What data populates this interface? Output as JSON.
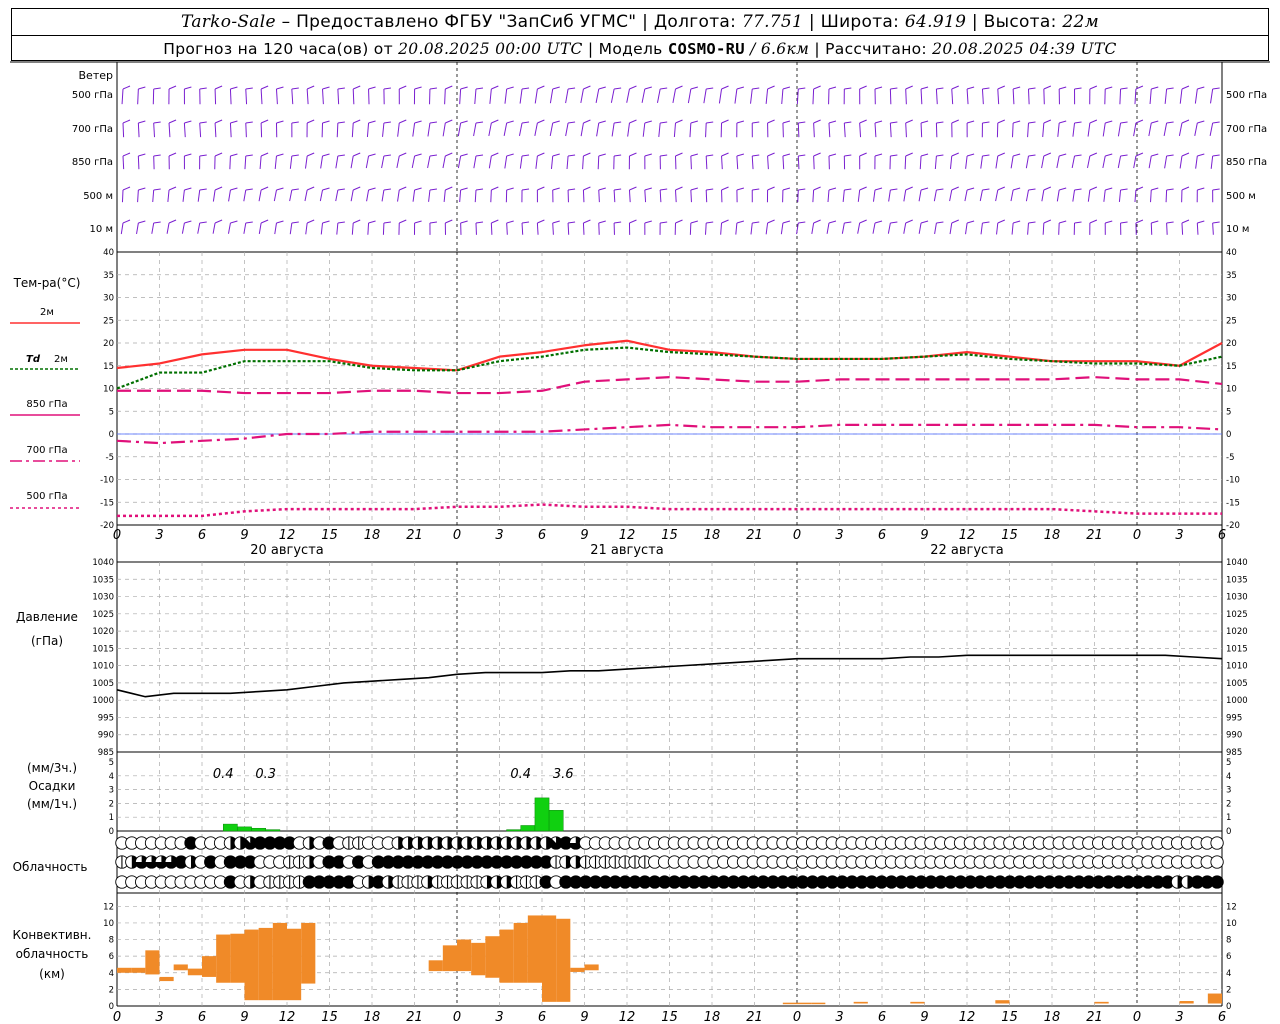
{
  "header": {
    "station": "Tarko-Sale",
    "dash": "–",
    "provider": "Предоставлено ФГБУ \"ЗапСиб УГМС\"",
    "lon_label": "Долгота:",
    "lon_value": "77.751",
    "lat_label": "Широта:",
    "lat_value": "64.919",
    "alt_label": "Высота:",
    "alt_value": "22м",
    "forecast_prefix": "Прогноз на 120 часа(ов) от",
    "forecast_time": "20.08.2025 00:00 UTC",
    "model_label": "Модель",
    "model_name": "COSMO-RU",
    "model_res": "/ 6.6км",
    "computed_label": "Рассчитано:",
    "computed_time": "20.08.2025 04:39 UTC"
  },
  "wind_panel": {
    "title": "Ветер",
    "levels": [
      "500 гПа",
      "700 гПа",
      "850 гПа",
      "500 м",
      "10  м"
    ],
    "color": "#7a1fd0"
  },
  "time_axis": {
    "hours": [
      "0",
      "3",
      "6",
      "9",
      "12",
      "15",
      "18",
      "21",
      "0",
      "3",
      "6",
      "9",
      "12",
      "15",
      "18",
      "21",
      "0",
      "3",
      "6",
      "9",
      "12",
      "15",
      "18",
      "21",
      "0",
      "3",
      "6"
    ],
    "dates": [
      "20 августа",
      "21 августа",
      "22 августа"
    ]
  },
  "legend": {
    "temp_title": "Тем-ра(°С)",
    "t2m": "2м",
    "td": "Td",
    "td_suffix": "2м",
    "t850": "850 гПа",
    "t700": "700 гПа",
    "t500": "500 гПа",
    "pressure_title": "Давление",
    "pressure_unit": "(гПа)",
    "precip_unit3": "(мм/3ч.)",
    "precip_title": "Осадки",
    "precip_unit1": "(мм/1ч.)",
    "cloud_title": "Облачность",
    "conv_title1": "Конвективн.",
    "conv_title2": "облачность",
    "conv_unit": "(км)"
  },
  "colors": {
    "t2m": "#ff3030",
    "td": "#007000",
    "levels": "#e0107a",
    "precip": "#10d010",
    "convective": "#f08a28",
    "pressure": "#000000"
  },
  "chart_data": [
    {
      "type": "line",
      "title": "Тем-ра(°С)",
      "ylim": [
        -20,
        40
      ],
      "yticks": [
        -20,
        -15,
        -10,
        -5,
        0,
        5,
        10,
        15,
        20,
        25,
        30,
        35,
        40
      ],
      "x_hours": [
        0,
        3,
        6,
        9,
        12,
        15,
        18,
        21,
        24,
        27,
        30,
        33,
        36,
        39,
        42,
        45,
        48,
        51,
        54,
        57,
        60,
        63,
        66,
        69,
        72,
        75,
        78
      ],
      "series": [
        {
          "name": "2м",
          "values": [
            14.5,
            15.5,
            17.5,
            18.5,
            18.5,
            16.5,
            15,
            14.5,
            14,
            17,
            18,
            19.5,
            20.5,
            18.5,
            18,
            17,
            16.5,
            16.5,
            16.5,
            17,
            18,
            17,
            16,
            16,
            16,
            15,
            20
          ]
        },
        {
          "name": "Td 2м",
          "values": [
            10,
            13.5,
            13.5,
            16,
            16,
            16,
            14.5,
            14,
            14,
            16,
            17,
            18.5,
            19,
            18,
            17.5,
            17,
            16.5,
            16.5,
            16.5,
            17,
            17.5,
            16.5,
            16,
            15.5,
            15.5,
            15,
            17
          ]
        },
        {
          "name": "850 гПа",
          "values": [
            9.5,
            9.5,
            9.5,
            9,
            9,
            9,
            9.5,
            9.5,
            9,
            9,
            9.5,
            11.5,
            12,
            12.5,
            12,
            11.5,
            11.5,
            12,
            12,
            12,
            12,
            12,
            12,
            12.5,
            12,
            12,
            11
          ]
        },
        {
          "name": "700 гПа",
          "values": [
            -1.5,
            -2,
            -1.5,
            -1,
            0,
            0,
            0.5,
            0.5,
            0.5,
            0.5,
            0.5,
            1,
            1.5,
            2,
            1.5,
            1.5,
            1.5,
            2,
            2,
            2,
            2,
            2,
            2,
            2,
            1.5,
            1.5,
            1
          ]
        },
        {
          "name": "500 гПа",
          "values": [
            -18,
            -18,
            -18,
            -17,
            -16.5,
            -16.5,
            -16.5,
            -16.5,
            -16,
            -16,
            -15.5,
            -16,
            -16,
            -16.5,
            -16.5,
            -16.5,
            -16.5,
            -16.5,
            -16.5,
            -16.5,
            -16.5,
            -16.5,
            -16.5,
            -17,
            -17.5,
            -17.5,
            -17.5
          ]
        }
      ]
    },
    {
      "type": "line",
      "title": "Давление",
      "ylabel": "(гПа)",
      "ylim": [
        985,
        1040
      ],
      "yticks": [
        985,
        990,
        995,
        1000,
        1005,
        1010,
        1015,
        1020,
        1025,
        1030,
        1035,
        1040
      ],
      "x_hours": [
        0,
        2,
        4,
        6,
        8,
        10,
        12,
        14,
        16,
        18,
        20,
        22,
        24,
        26,
        28,
        30,
        32,
        34,
        36,
        38,
        40,
        42,
        44,
        46,
        48,
        50,
        52,
        54,
        56,
        58,
        60,
        62,
        64,
        66,
        68,
        70,
        72,
        74,
        76,
        78
      ],
      "series": [
        {
          "name": "Давление",
          "values": [
            1003,
            1001,
            1002,
            1002,
            1002,
            1002.5,
            1003,
            1004,
            1005,
            1005.5,
            1006,
            1006.5,
            1007.5,
            1008,
            1008,
            1008,
            1008.5,
            1008.5,
            1009,
            1009.5,
            1010,
            1010.5,
            1011,
            1011.5,
            1012,
            1012,
            1012,
            1012,
            1012.5,
            1012.5,
            1013,
            1013,
            1013,
            1013,
            1013,
            1013,
            1013,
            1013,
            1012.5,
            1012
          ]
        }
      ]
    },
    {
      "type": "bar",
      "title": "Осадки",
      "ylabel": "(мм/1ч.)",
      "ylim": [
        0,
        5
      ],
      "yticks": [
        0,
        1,
        2,
        3,
        4,
        5
      ],
      "x_hours": [
        8,
        9,
        10,
        11,
        28,
        29,
        30,
        31
      ],
      "values": [
        0.5,
        0.3,
        0.2,
        0.1,
        0.1,
        0.4,
        2.4,
        1.5
      ],
      "annotations": [
        {
          "hour": 7.5,
          "text": "0.4"
        },
        {
          "hour": 10.5,
          "text": "0.3"
        },
        {
          "hour": 28.5,
          "text": "0.4"
        },
        {
          "hour": 31.5,
          "text": "3.6"
        }
      ]
    },
    {
      "type": "bar",
      "title": "Конвективн. облачность",
      "ylabel": "(км)",
      "ylim": [
        0,
        13
      ],
      "yticks": [
        0,
        2,
        4,
        6,
        8,
        10,
        12
      ],
      "floating_bars": [
        {
          "hour": 0.5,
          "bottom": 4,
          "top": 4.6
        },
        {
          "hour": 1.5,
          "bottom": 4,
          "top": 4.6
        },
        {
          "hour": 2.5,
          "bottom": 3.8,
          "top": 6.7
        },
        {
          "hour": 3.5,
          "bottom": 3,
          "top": 3.5
        },
        {
          "hour": 4.5,
          "bottom": 4.3,
          "top": 5
        },
        {
          "hour": 5.5,
          "bottom": 3.7,
          "top": 4.5
        },
        {
          "hour": 6.5,
          "bottom": 3.5,
          "top": 6
        },
        {
          "hour": 7.5,
          "bottom": 2.8,
          "top": 8.6
        },
        {
          "hour": 8.5,
          "bottom": 2.8,
          "top": 8.7
        },
        {
          "hour": 9.5,
          "bottom": 0.7,
          "top": 9.2
        },
        {
          "hour": 10.5,
          "bottom": 0.7,
          "top": 9.4
        },
        {
          "hour": 11.5,
          "bottom": 0.7,
          "top": 10
        },
        {
          "hour": 12.5,
          "bottom": 0.7,
          "top": 9.3
        },
        {
          "hour": 13.5,
          "bottom": 2.7,
          "top": 10
        },
        {
          "hour": 22.5,
          "bottom": 4.2,
          "top": 5.5
        },
        {
          "hour": 23.5,
          "bottom": 4.2,
          "top": 7.3
        },
        {
          "hour": 24.5,
          "bottom": 4.2,
          "top": 8
        },
        {
          "hour": 25.5,
          "bottom": 3.7,
          "top": 7.6
        },
        {
          "hour": 26.5,
          "bottom": 3.4,
          "top": 8.4
        },
        {
          "hour": 27.5,
          "bottom": 2.8,
          "top": 9.2
        },
        {
          "hour": 28.5,
          "bottom": 2.8,
          "top": 10
        },
        {
          "hour": 29.5,
          "bottom": 2.8,
          "top": 10.9
        },
        {
          "hour": 30.5,
          "bottom": 0.5,
          "top": 10.9
        },
        {
          "hour": 31.5,
          "bottom": 0.5,
          "top": 10.5
        },
        {
          "hour": 32.5,
          "bottom": 4.1,
          "top": 4.6
        },
        {
          "hour": 33.5,
          "bottom": 4.3,
          "top": 5
        },
        {
          "hour": 47.5,
          "bottom": 0.3,
          "top": 0.4
        },
        {
          "hour": 48.5,
          "bottom": 0.3,
          "top": 0.4
        },
        {
          "hour": 49.5,
          "bottom": 0.3,
          "top": 0.4
        },
        {
          "hour": 52.5,
          "bottom": 0.3,
          "top": 0.5
        },
        {
          "hour": 56.5,
          "bottom": 0.3,
          "top": 0.5
        },
        {
          "hour": 62.5,
          "bottom": 0.3,
          "top": 0.7
        },
        {
          "hour": 69.5,
          "bottom": 0.3,
          "top": 0.5
        },
        {
          "hour": 75.5,
          "bottom": 0.3,
          "top": 0.6
        },
        {
          "hour": 77.5,
          "bottom": 0.3,
          "top": 1.5
        }
      ]
    }
  ],
  "cloud_rows": {
    "low": "0000000800033788880308011000333333333333333368500000000000000000000000000000000000000000000000000000000000000000",
    "mid": "1355558308288800011308808288888888888888888813311111110000000000000000000000000000000000000000000000000000000000",
    "high": "0000000000080301111888880383111311111333111808888888888888888888888888888888888888888888888888888888888888833888"
  }
}
